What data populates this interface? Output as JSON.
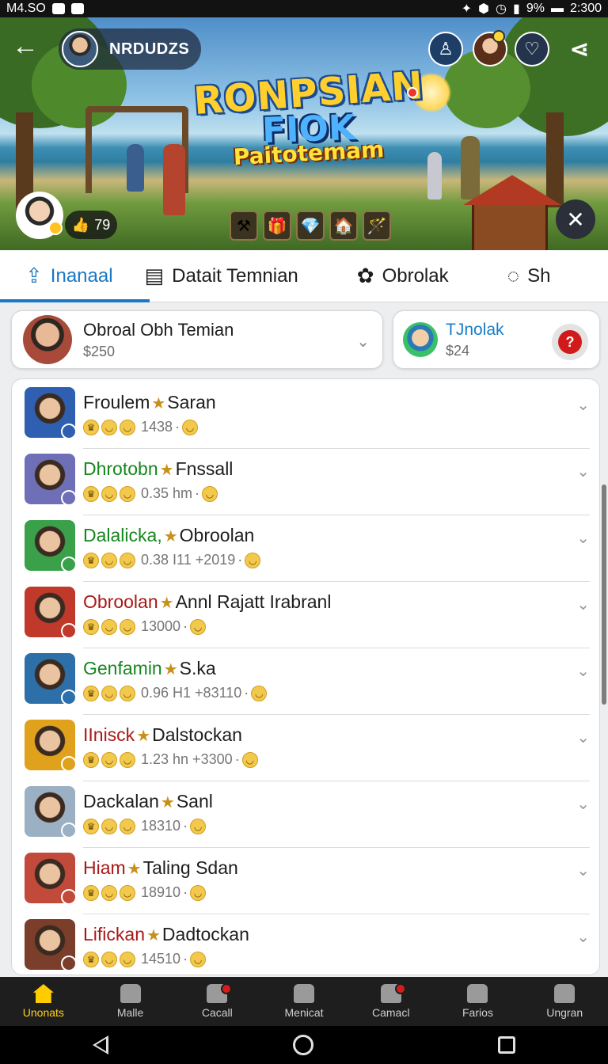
{
  "status_bar": {
    "left": "M4.SO",
    "battery": "9%",
    "time": "2:300"
  },
  "header": {
    "username": "NRDUDZS",
    "game_title_1": "RONPSIAN",
    "game_title_2": "FIOK",
    "game_title_3": "Paitotemam",
    "likes": "79"
  },
  "tabs": [
    {
      "label": "Inanaal",
      "icon": "share-icon",
      "active": true
    },
    {
      "label": "Datait Temnian",
      "icon": "chat-card-icon",
      "active": false
    },
    {
      "label": "Obrolak",
      "icon": "badge-icon",
      "active": false
    },
    {
      "label": "Sh",
      "icon": "speech-bubble-icon",
      "active": false
    }
  ],
  "cards": {
    "primary": {
      "title": "Obroal Obh Temian",
      "value": "$250"
    },
    "secondary": {
      "title": "TJnolak",
      "value": "$24",
      "help": "?"
    }
  },
  "list": [
    {
      "pre": "",
      "name": "Froulem",
      "name_color": "default",
      "post": "Saran",
      "meta": "1438",
      "accent": "#2f5fb0"
    },
    {
      "pre": "",
      "name": "Dhrotobn",
      "name_color": "green",
      "post": "Fnssall",
      "meta": "0.35 hm",
      "accent": "#6f6fb8"
    },
    {
      "pre": "",
      "name": "Dalalicka,",
      "name_color": "green",
      "post": "Obroolan",
      "meta": "0.38 I11 +2019",
      "accent": "#3aa04a"
    },
    {
      "pre": "",
      "name": "Obroolan",
      "name_color": "red",
      "post": "Annl Rajatt Irabranl",
      "meta": "13000",
      "accent": "#c0392b"
    },
    {
      "pre": "",
      "name": "Genfamin",
      "name_color": "green",
      "post": "S.ka",
      "meta": "0.96 H1 +83110",
      "accent": "#2d6fa8"
    },
    {
      "pre": "",
      "name": "IInisck",
      "name_color": "red",
      "post": "Dalstockan",
      "meta": "1.23 hn +3300",
      "accent": "#e0a21c"
    },
    {
      "pre": "",
      "name": "Dackalan",
      "name_color": "default",
      "post": "Sanl",
      "meta": "18310",
      "accent": "#9bb0c2"
    },
    {
      "pre": "",
      "name": "Hiam",
      "name_color": "red",
      "post": "Taling Sdan",
      "meta": "18910",
      "accent": "#c24a3a"
    },
    {
      "pre": "",
      "name": "Lifickan",
      "name_color": "red",
      "post": "Dadtockan",
      "meta": "14510",
      "accent": "#7a3e2a"
    }
  ],
  "bottom_nav": [
    {
      "label": "Unonats",
      "active": true,
      "badge": false
    },
    {
      "label": "Malle",
      "active": false,
      "badge": false
    },
    {
      "label": "Cacall",
      "active": false,
      "badge": true
    },
    {
      "label": "Menicat",
      "active": false,
      "badge": false
    },
    {
      "label": "Camacl",
      "active": false,
      "badge": true
    },
    {
      "label": "Farios",
      "active": false,
      "badge": false
    },
    {
      "label": "Ungran",
      "active": false,
      "badge": false
    }
  ],
  "colors": {
    "accent": "#1977c4",
    "nav_active": "#ffd21c",
    "green_name": "#16861e",
    "red_name": "#a81818"
  }
}
